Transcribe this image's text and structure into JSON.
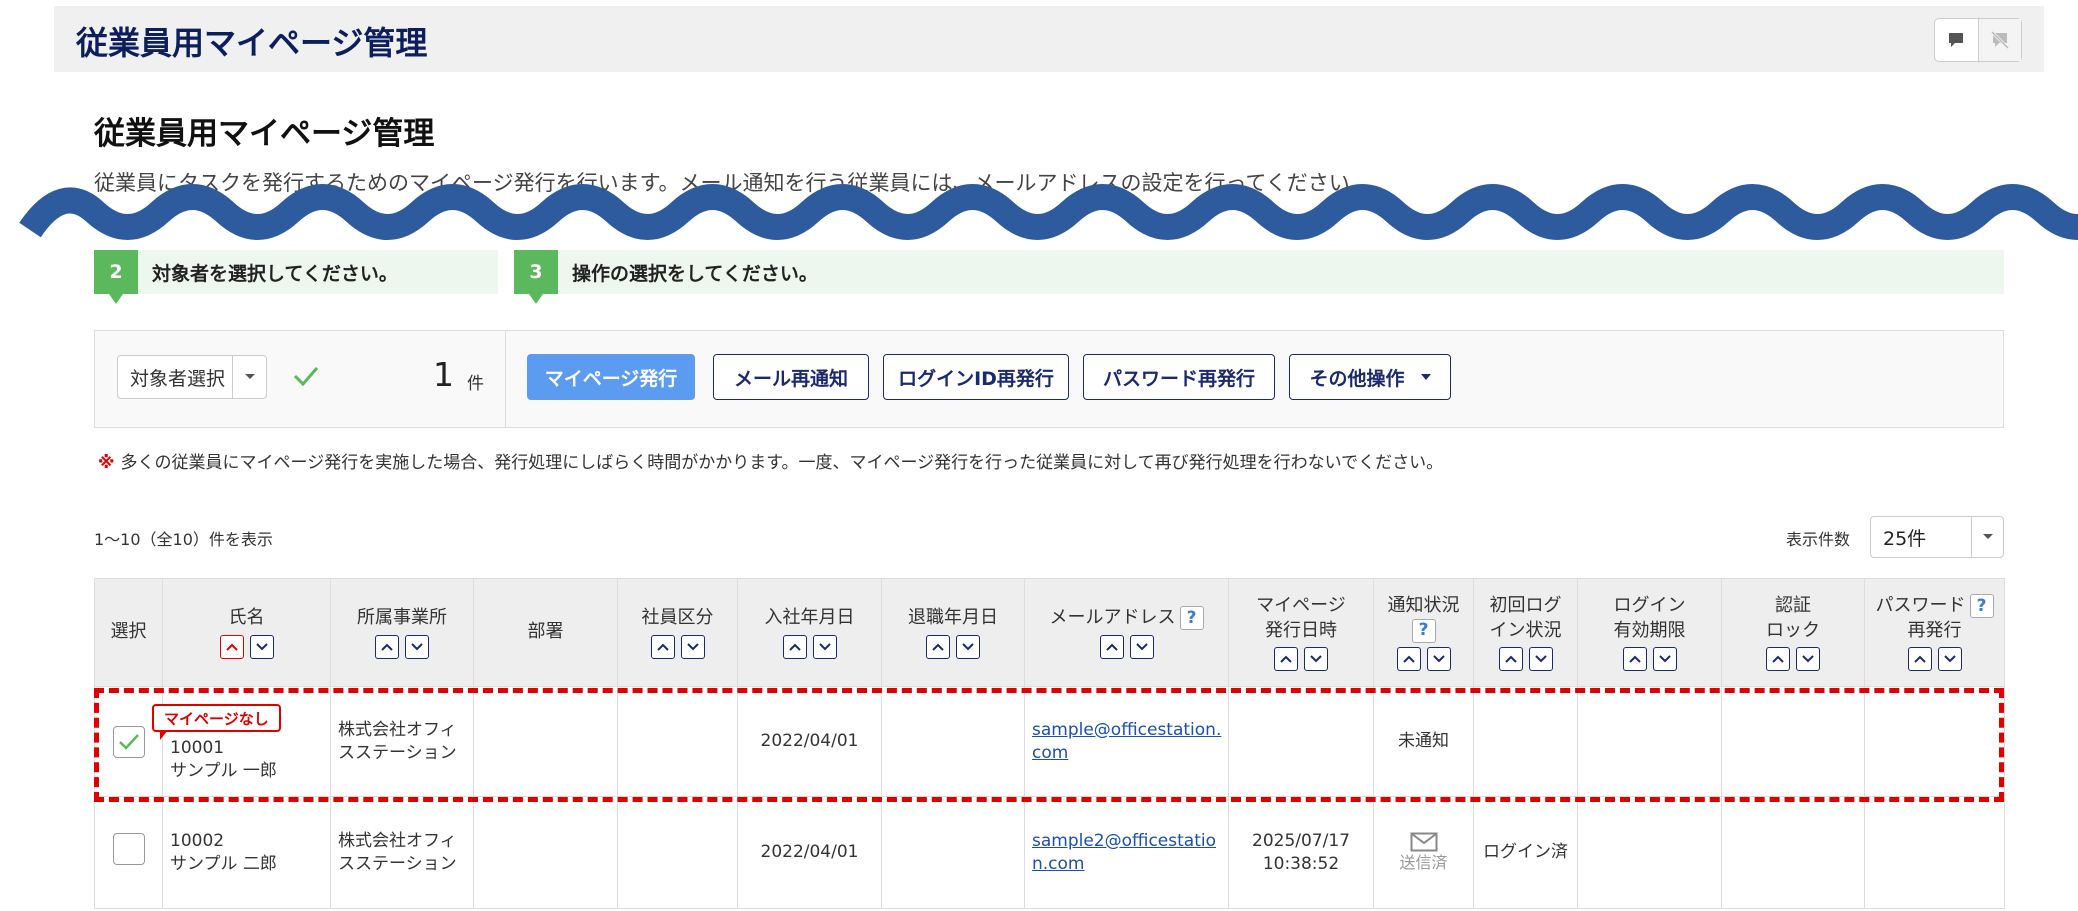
{
  "header": {
    "title": "従業員用マイページ管理"
  },
  "page": {
    "heading": "従業員用マイページ管理",
    "description": "従業員にタスクを発行するためのマイページ発行を行います。メール通知を行う従業員には、メールアドレスの設定を行ってください。"
  },
  "steps": [
    {
      "number": "2",
      "text": "対象者を選択してください。"
    },
    {
      "number": "3",
      "text": "操作の選択をしてください。"
    }
  ],
  "operation": {
    "target_select": "対象者選択",
    "count": "1",
    "count_unit": "件",
    "buttons": {
      "issue": "マイページ発行",
      "resend_mail": "メール再通知",
      "reissue_login_id": "ログインID再発行",
      "reissue_password": "パスワード再発行",
      "other": "その他操作"
    }
  },
  "notice": {
    "mark": "※",
    "text": "多くの従業員にマイページ発行を実施した場合、発行処理にしばらく時間がかかります。一度、マイページ発行を行った従業員に対して再び発行処理を行わないでください。"
  },
  "list": {
    "result_count": "1〜10（全10）件を表示",
    "per_page_label": "表示件数",
    "per_page_value": "25件"
  },
  "table": {
    "headers": {
      "select": "選択",
      "name": "氏名",
      "office": "所属事業所",
      "department": "部署",
      "employee_type": "社員区分",
      "hire_date": "入社年月日",
      "retire_date": "退職年月日",
      "email": "メールアドレス",
      "mypage_issue_l1": "マイページ",
      "mypage_issue_l2": "発行日時",
      "notify_status": "通知状況",
      "first_login_l1": "初回ログ",
      "first_login_l2": "イン状況",
      "login_expiry_l1": "ログイン",
      "login_expiry_l2": "有効期限",
      "auth_lock_l1": "認証",
      "auth_lock_l2": "ロック",
      "password_reissue_l1": "パスワード",
      "password_reissue_l2": "再発行",
      "help": "?"
    },
    "rows": [
      {
        "badge": "マイページなし",
        "checked": true,
        "emp_no": "10001",
        "name": "サンプル 一郎",
        "office": "株式会社オフィスステーション",
        "department": "",
        "employee_type": "",
        "hire_date": "2022/04/01",
        "retire_date": "",
        "email": "sample@officestation.com",
        "issue_datetime_date": "",
        "issue_datetime_time": "",
        "notify_status": "未通知",
        "first_login": ""
      },
      {
        "checked": false,
        "emp_no": "10002",
        "name": "サンプル 二郎",
        "office": "株式会社オフィスステーション",
        "department": "",
        "employee_type": "",
        "hire_date": "2022/04/01",
        "retire_date": "",
        "email": "sample2@officestation.com",
        "issue_datetime_date": "2025/07/17",
        "issue_datetime_time": "10:38:52",
        "notify_status": "送信済",
        "first_login": "ログイン済"
      }
    ]
  },
  "colors": {
    "header_title": "#0d1e5c",
    "primary_button": "#5b9cf0",
    "step_green": "#5cb85c",
    "highlight_red": "#e00000",
    "wave_blue": "#2e5b9e"
  }
}
